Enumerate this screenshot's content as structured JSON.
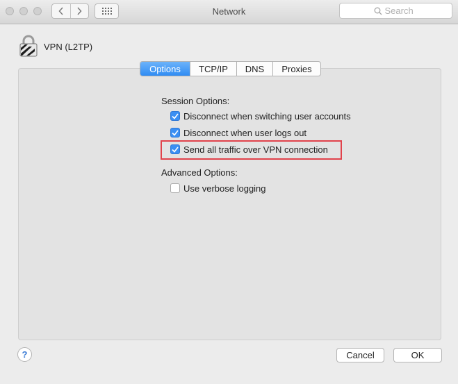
{
  "window": {
    "title": "Network"
  },
  "toolbar": {
    "back_icon": "chevron-left-icon",
    "forward_icon": "chevron-right-icon",
    "grid_icon": "grid-icon",
    "search_placeholder": "Search"
  },
  "service": {
    "name": "VPN (L2TP)",
    "icon": "lock-icon"
  },
  "tabs": [
    {
      "label": "Options",
      "active": true
    },
    {
      "label": "TCP/IP",
      "active": false
    },
    {
      "label": "DNS",
      "active": false
    },
    {
      "label": "Proxies",
      "active": false
    }
  ],
  "session": {
    "heading": "Session Options:",
    "options": [
      {
        "label": "Disconnect when switching user accounts",
        "checked": true
      },
      {
        "label": "Disconnect when user logs out",
        "checked": true
      },
      {
        "label": "Send all traffic over VPN connection",
        "checked": true,
        "highlighted": true
      }
    ]
  },
  "advanced": {
    "heading": "Advanced Options:",
    "options": [
      {
        "label": "Use verbose logging",
        "checked": false
      }
    ]
  },
  "footer": {
    "help_label": "?",
    "cancel_label": "Cancel",
    "ok_label": "OK"
  },
  "colors": {
    "accent": "#3b8ff3",
    "highlight_border": "#e1424b"
  }
}
